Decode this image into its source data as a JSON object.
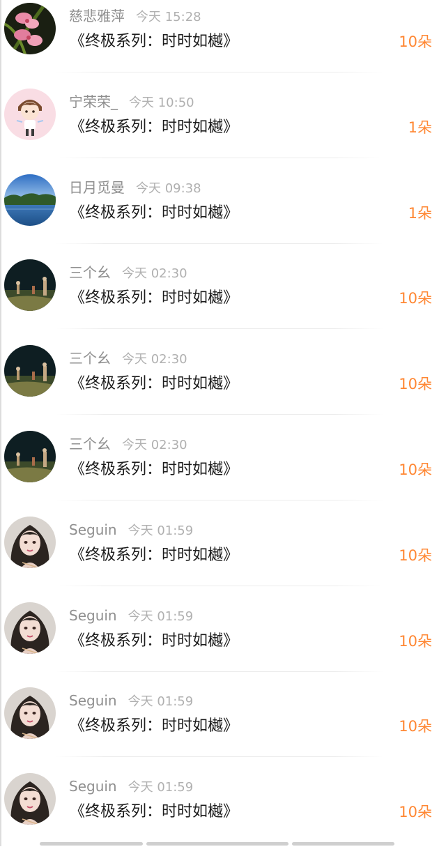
{
  "entries": [
    {
      "username": "慈悲雅萍",
      "time": "今天 15:28",
      "title": "《终极系列：时时如樾》",
      "count": "10朵",
      "avatar_icon": "orchid-flower-avatar"
    },
    {
      "username": "宁荣荣_",
      "time": "今天 10:50",
      "title": "《终极系列：时时如樾》",
      "count": "1朵",
      "avatar_icon": "cartoon-boy-avatar"
    },
    {
      "username": "日月觅曼",
      "time": "今天 09:38",
      "title": "《终极系列：时时如樾》",
      "count": "1朵",
      "avatar_icon": "lake-landscape-avatar"
    },
    {
      "username": "三个幺",
      "time": "今天 02:30",
      "title": "《终极系列：时时如樾》",
      "count": "10朵",
      "avatar_icon": "night-field-avatar"
    },
    {
      "username": "三个幺",
      "time": "今天 02:30",
      "title": "《终极系列：时时如樾》",
      "count": "10朵",
      "avatar_icon": "night-field-avatar"
    },
    {
      "username": "三个幺",
      "time": "今天 02:30",
      "title": "《终极系列：时时如樾》",
      "count": "10朵",
      "avatar_icon": "night-field-avatar"
    },
    {
      "username": "Seguin",
      "time": "今天 01:59",
      "title": "《终极系列：时时如樾》",
      "count": "10朵",
      "avatar_icon": "illustrated-girl-avatar"
    },
    {
      "username": "Seguin",
      "time": "今天 01:59",
      "title": "《终极系列：时时如樾》",
      "count": "10朵",
      "avatar_icon": "illustrated-girl-avatar"
    },
    {
      "username": "Seguin",
      "time": "今天 01:59",
      "title": "《终极系列：时时如樾》",
      "count": "10朵",
      "avatar_icon": "illustrated-girl-avatar"
    },
    {
      "username": "Seguin",
      "time": "今天 01:59",
      "title": "《终极系列：时时如樾》",
      "count": "10朵",
      "avatar_icon": "illustrated-girl-avatar"
    }
  ],
  "colors": {
    "count": "#ff8733",
    "username": "#8f8f8f",
    "time": "#b0b0b0",
    "title": "#1d1d1d"
  }
}
